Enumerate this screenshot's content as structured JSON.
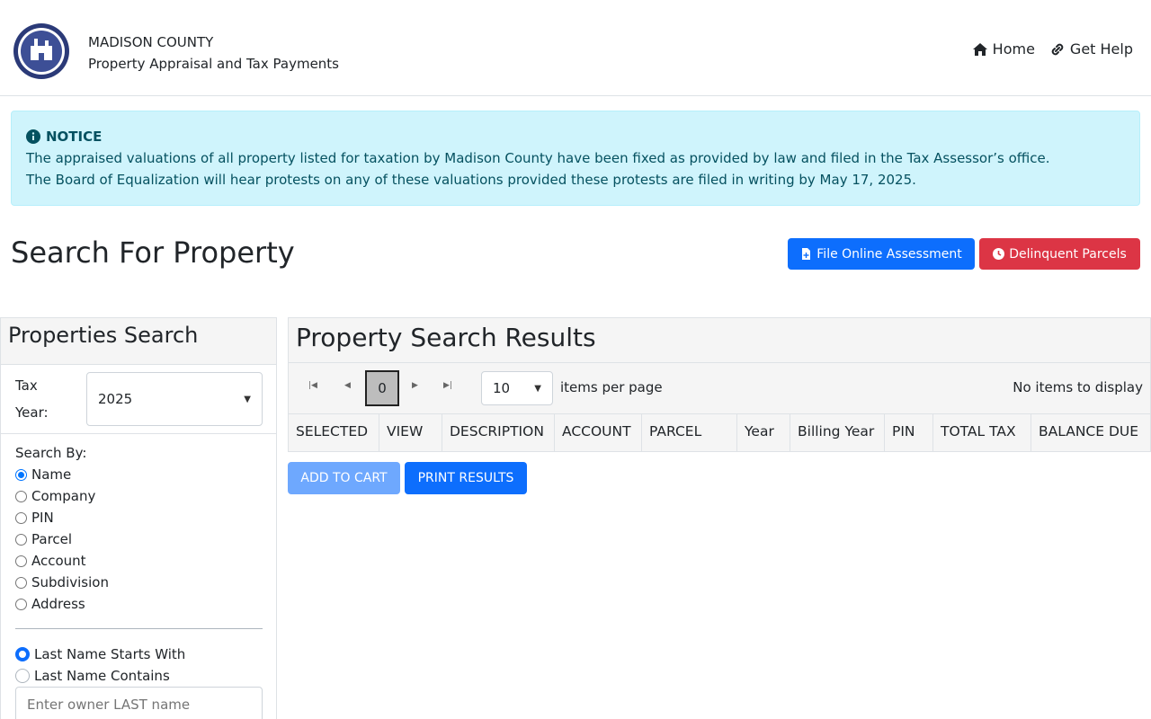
{
  "header": {
    "county": "MADISON COUNTY",
    "subtitle": "Property Appraisal and Tax Payments",
    "nav": {
      "home": "Home",
      "help": "Get Help"
    },
    "logo_icon": "county-seal-icon"
  },
  "notice": {
    "title": "NOTICE",
    "line1": "The appraised valuations of all property listed for taxation by Madison County have been fixed as provided by law and filed in the Tax Assessor’s office.",
    "line2": "The Board of Equalization will hear protests on any of these valuations provided these protests are filed in writing by May 17, 2025."
  },
  "page": {
    "title": "Search For Property",
    "file_btn": "File Online Assessment",
    "delinquent_btn": "Delinquent Parcels"
  },
  "search": {
    "title": "Properties Search",
    "tax_year_label_1": "Tax",
    "tax_year_label_2": "Year:",
    "tax_year_value": "2025",
    "search_by_label": "Search By:",
    "options": [
      "Name",
      "Company",
      "PIN",
      "Parcel",
      "Account",
      "Subdivision",
      "Address"
    ],
    "selected_option": "Name",
    "match_options": [
      "Last Name Starts With",
      "Last Name Contains"
    ],
    "selected_match": "Last Name Starts With",
    "placeholder": "Enter owner LAST name"
  },
  "results": {
    "title": "Property Search Results",
    "current_page": "0",
    "page_size": "10",
    "items_per_page": "items per page",
    "no_items": "No items to display",
    "columns": [
      "SELECTED",
      "VIEW",
      "DESCRIPTION",
      "ACCOUNT",
      "PARCEL",
      "Year",
      "Billing Year",
      "PIN",
      "TOTAL TAX",
      "BALANCE DUE"
    ],
    "add_to_cart": "ADD TO CART",
    "print_results": "PRINT RESULTS"
  },
  "colors": {
    "primary": "#0d6efd",
    "danger": "#dc3545",
    "notice_bg": "#cff4fc",
    "notice_text": "#055160"
  }
}
